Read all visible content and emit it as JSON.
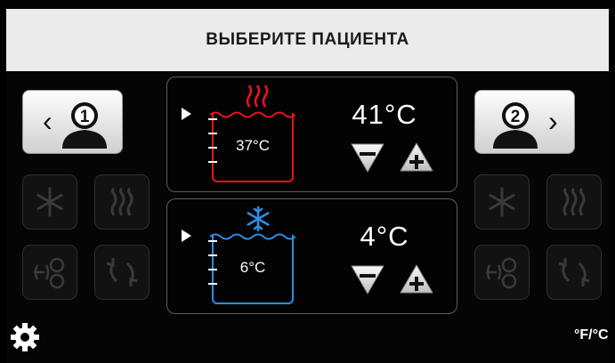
{
  "header": {
    "title": "ВЫБЕРИТЕ ПАЦИЕНТА"
  },
  "patient_left": {
    "chevron": "‹",
    "number": "1"
  },
  "patient_right": {
    "chevron": "›",
    "number": "2"
  },
  "heat_panel": {
    "set_temp": "41°C",
    "water_temp": "37°C",
    "mode_icon": "heat-waves-icon",
    "color": "#e8141e"
  },
  "cool_panel": {
    "set_temp": "4°C",
    "water_temp": "6°C",
    "mode_icon": "snowflake-icon",
    "color": "#2a8ee6"
  },
  "minus_label": "−",
  "plus_label": "+",
  "unit_toggle": {
    "label": "°F/°C"
  }
}
